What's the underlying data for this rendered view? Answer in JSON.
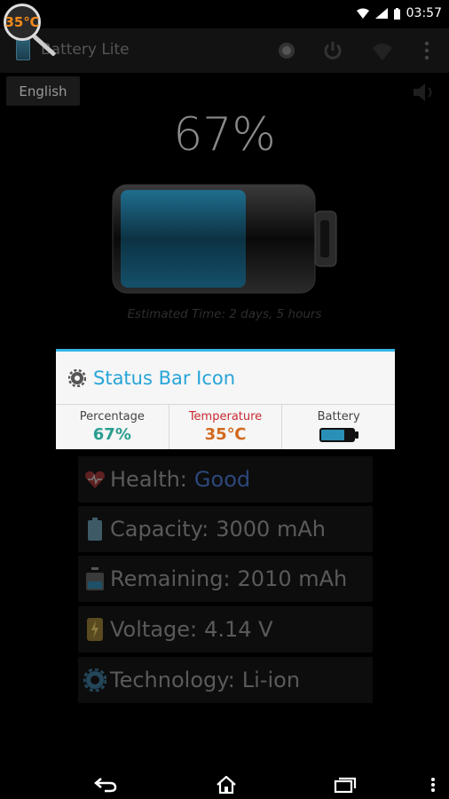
{
  "status_bar": {
    "temp_badge": "35℃",
    "time": "03:57",
    "icons": [
      "wifi-icon",
      "signal-icon",
      "battery-icon"
    ]
  },
  "app_bar": {
    "title": "Battery Lite",
    "actions": [
      "brightness-icon",
      "power-icon",
      "wifi-toggle-icon",
      "overflow-menu-icon"
    ]
  },
  "language": "English",
  "battery": {
    "percent_text": "67%",
    "level": 0.67,
    "estimated_time": "Estimated Time: 2 days, 5 hours"
  },
  "popup": {
    "title": "Status Bar Icon",
    "options": [
      {
        "label": "Percentage",
        "value": "67%"
      },
      {
        "label": "Temperature",
        "value": "35℃"
      },
      {
        "label": "Battery",
        "value": ""
      }
    ]
  },
  "info": {
    "health": {
      "label": "Health:",
      "value": "Good"
    },
    "capacity": {
      "label": "Capacity:",
      "value": "3000 mAh"
    },
    "remaining": {
      "label": "Remaining:",
      "value": "2010 mAh"
    },
    "voltage": {
      "label": "Voltage:",
      "value": "4.14 V"
    },
    "technology": {
      "label": "Technology:",
      "value": "Li-ion"
    }
  },
  "colors": {
    "accent": "#33b5e5",
    "percentage": "#2a9d8f",
    "temperature": "#d2691e"
  }
}
